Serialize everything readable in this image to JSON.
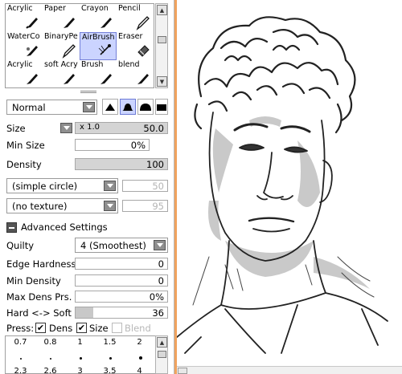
{
  "tools": {
    "row1": [
      "Acrylic",
      "Paper",
      "Crayon",
      "Pencil"
    ],
    "row2": [
      "WaterCo",
      "BinaryPe",
      "AirBrush",
      "Eraser"
    ],
    "row3": [
      "Acrylic",
      "soft Acry",
      "Brush",
      "blend"
    ],
    "selected": "AirBrush"
  },
  "blend_mode": "Normal",
  "size": {
    "label": "Size",
    "multiplier": "x 1.0",
    "value": "50.0"
  },
  "min_size": {
    "label": "Min Size",
    "value": "0%"
  },
  "density": {
    "label": "Density",
    "value": "100"
  },
  "brush_shape": {
    "value": "(simple circle)",
    "amount": "50"
  },
  "texture": {
    "value": "(no texture)",
    "amount": "95"
  },
  "advanced": {
    "title": "Advanced Settings",
    "quality_label": "Quilty",
    "quality_value": "4 (Smoothest)",
    "edge_hardness_label": "Edge Hardness",
    "edge_hardness_value": "0",
    "min_density_label": "Min Density",
    "min_density_value": "0",
    "max_dens_label": "Max Dens Prs.",
    "max_dens_value": "0%",
    "hard_soft_label": "Hard <-> Soft",
    "hard_soft_value": "36",
    "press_label": "Press:",
    "dens_label": "Dens",
    "size_label": "Size",
    "blend_label": "Blend"
  },
  "brush_sizes": {
    "row1": [
      "0.7",
      "0.8",
      "1",
      "1.5",
      "2"
    ],
    "row3": [
      "2.3",
      "2.6",
      "3",
      "3.5",
      "4"
    ]
  },
  "colors": {
    "accent_strip": "#f0a35e",
    "selection": "#cbd4ff"
  }
}
